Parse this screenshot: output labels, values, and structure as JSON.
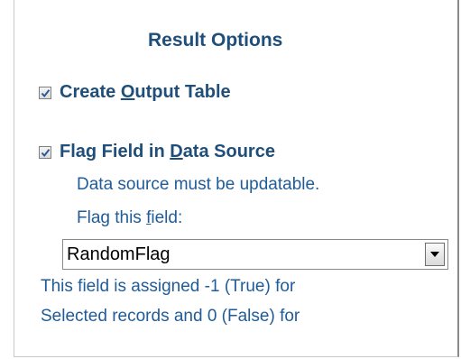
{
  "panel": {
    "title": "Result Options"
  },
  "options": [
    {
      "checked": true,
      "label_pre": "Create ",
      "label_accel": "O",
      "label_post": "utput Table"
    },
    {
      "checked": true,
      "label_pre": "Flag Field in ",
      "label_accel": "D",
      "label_post": "ata Source"
    }
  ],
  "flag_section": {
    "note": "Data source must be updatable.",
    "field_label_pre": "Flag this ",
    "field_label_accel": "f",
    "field_label_post": "ield:",
    "selected_field": "RandomFlag",
    "dropdown_icon": "dropdown-arrow-icon"
  },
  "info_lines": [
    "This field is assigned -1 (True) for",
    "Selected records and 0 (False) for"
  ],
  "colors": {
    "heading": "#1e4e79",
    "text": "#1f5c99",
    "check": "#2a5a96"
  }
}
